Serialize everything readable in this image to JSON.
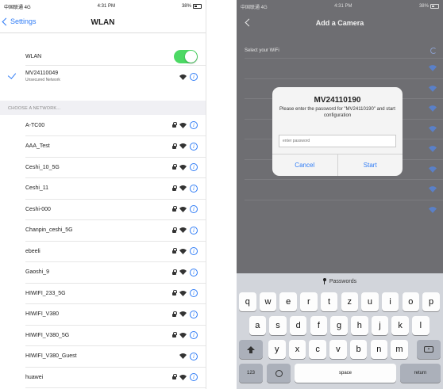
{
  "colors": {
    "accent": "#2f7cf6",
    "toggle_on": "#4cd964",
    "dim_wifi": "#5a80c8"
  },
  "left": {
    "status": {
      "carrier": "中国联通 4G",
      "time": "4:31 PM",
      "battery": "38%"
    },
    "nav": {
      "back": "Settings",
      "title": "WLAN"
    },
    "wlan": {
      "label": "WLAN",
      "enabled": true
    },
    "connected": {
      "name": "MV24110049",
      "sub": "Unsecured Network"
    },
    "section": "CHOOSE A NETWORK...",
    "networks": [
      {
        "name": "A-TC00",
        "secured": true
      },
      {
        "name": "AAA_Test",
        "secured": true
      },
      {
        "name": "Ceshi_10_5G",
        "secured": true
      },
      {
        "name": "Ceshi_11",
        "secured": true
      },
      {
        "name": "Ceshi-000",
        "secured": true
      },
      {
        "name": "Chanpin_ceshi_5G",
        "secured": true
      },
      {
        "name": "ebeeli",
        "secured": true
      },
      {
        "name": "Gaoshi_9",
        "secured": true
      },
      {
        "name": "HIWIFI_233_5G",
        "secured": true
      },
      {
        "name": "HIWIFI_V380",
        "secured": true
      },
      {
        "name": "HIWIFI_V380_5G",
        "secured": true
      },
      {
        "name": "HIWIFI_V380_Guest",
        "secured": false
      },
      {
        "name": "huawei",
        "secured": true
      }
    ]
  },
  "right": {
    "status": {
      "carrier": "中国联通 4G",
      "time": "4:31 PM",
      "battery": "38%"
    },
    "nav": {
      "title": "Add a Camera"
    },
    "header": "Select your WiFi",
    "networks": [
      "Chanpin_ceshi+1",
      "MV2411",
      "MV2522",
      "Xiaomi_",
      "Gaoshi_",
      "TP-LINK_8928",
      "Test9",
      "MV26408575"
    ],
    "dialog": {
      "title": "MV24110190",
      "message": "Please enter the password for \"MV24110190\" and start configuration",
      "placeholder": "enter password",
      "cancel": "Cancel",
      "start": "Start"
    },
    "keyboard": {
      "bar": "Passwords",
      "row1": [
        "q",
        "w",
        "e",
        "r",
        "t",
        "z",
        "u",
        "i",
        "o",
        "p"
      ],
      "row2": [
        "a",
        "s",
        "d",
        "f",
        "g",
        "h",
        "j",
        "k",
        "l"
      ],
      "row3": [
        "y",
        "x",
        "c",
        "v",
        "b",
        "n",
        "m"
      ],
      "num": "123",
      "space": "space",
      "return": "return"
    }
  }
}
